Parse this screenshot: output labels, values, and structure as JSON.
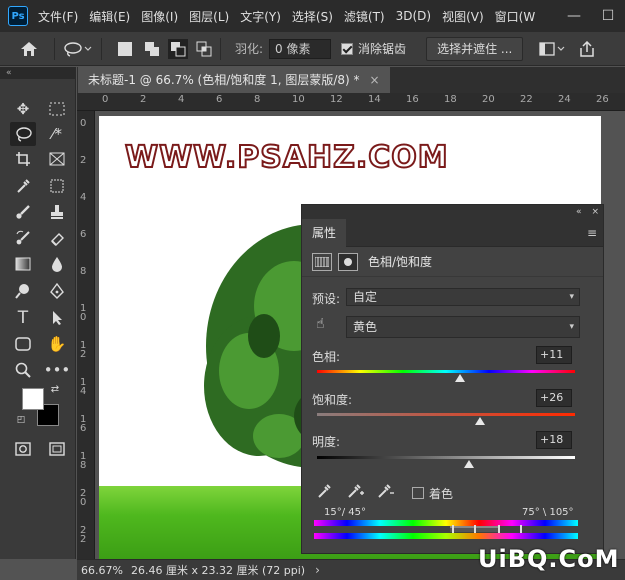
{
  "app": {
    "logo": "Ps"
  },
  "menu": [
    "文件(F)",
    "编辑(E)",
    "图像(I)",
    "图层(L)",
    "文字(Y)",
    "选择(S)",
    "滤镜(T)",
    "3D(D)",
    "视图(V)",
    "窗口(W"
  ],
  "window_controls": {
    "minimize": "—",
    "maximize": "☐"
  },
  "options": {
    "feather_label": "羽化:",
    "feather_value": "0 像素",
    "antialias_label": "消除锯齿",
    "antialias_checked": true,
    "select_mask_label": "选择并遮住 ..."
  },
  "document_tab": {
    "title": "未标题-1 @ 66.7% (色相/饱和度 1, 图层蒙版/8) *",
    "close": "×"
  },
  "toolbar": {
    "collapse": "«"
  },
  "ruler": {
    "top": [
      "0",
      "2",
      "4",
      "6",
      "8",
      "10",
      "12",
      "14",
      "16",
      "18",
      "20",
      "22",
      "24",
      "26"
    ],
    "left": [
      "0",
      "2",
      "4",
      "6",
      "8",
      "1 0",
      "1 2",
      "1 4",
      "1 6",
      "1 8",
      "2 0",
      "2 2"
    ]
  },
  "canvas": {
    "watermark": "WWW.PSAHZ.COM"
  },
  "status": {
    "zoom": "66.67%",
    "doc_size": "26.46 厘米 x 23.32 厘米 (72 ppi)",
    "arrow": "›"
  },
  "panel": {
    "header_controls": {
      "collapse": "«",
      "close": "×"
    },
    "tab": "属性",
    "menu_icon": "≡",
    "adjustment_title": "色相/饱和度",
    "preset_label": "预设:",
    "preset_value": "自定",
    "channel_value": "黄色",
    "hue_label": "色相:",
    "hue_value": "+11",
    "saturation_label": "饱和度:",
    "saturation_value": "+26",
    "lightness_label": "明度:",
    "lightness_value": "+18",
    "colorize_label": "着色",
    "colorize_checked": false,
    "range_left": "15°/ 45°",
    "range_right": "75° \\ 105°",
    "hue_slider_pos": 0.555,
    "sat_slider_pos": 0.63,
    "light_slider_pos": 0.59
  },
  "bottom_logo": "UiBQ.CoM"
}
